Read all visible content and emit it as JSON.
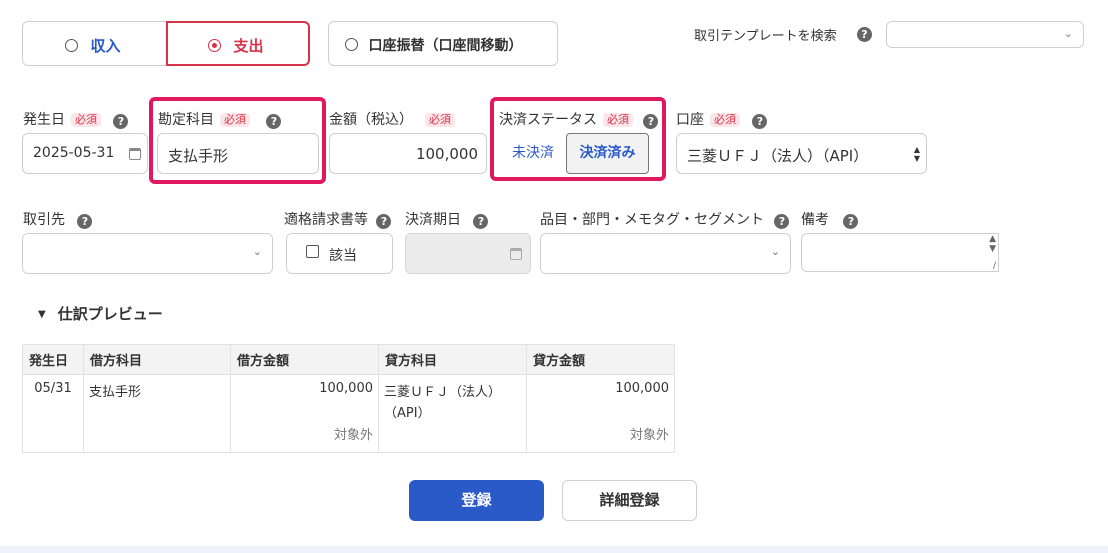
{
  "tabs": {
    "income": "収入",
    "expense": "支出",
    "transfer": "口座振替（口座間移動）"
  },
  "template_search": {
    "label": "取引テンプレートを検索",
    "value": ""
  },
  "required_badge": "必須",
  "fields": {
    "date": {
      "label": "発生日",
      "value": "2025-05-31"
    },
    "account_title": {
      "label": "勘定科目",
      "value": "支払手形"
    },
    "amount": {
      "label": "金額（税込）",
      "value": "100,000"
    },
    "status": {
      "label": "決済ステータス",
      "options": [
        "未決済",
        "決済済み"
      ],
      "selected": "決済済み"
    },
    "account": {
      "label": "口座",
      "value": "三菱ＵＦＪ（法人）（API）"
    },
    "partner": {
      "label": "取引先",
      "value": ""
    },
    "invoice": {
      "label": "適格請求書等",
      "checkbox_label": "該当",
      "checked": false
    },
    "due_date": {
      "label": "決済期日",
      "value": ""
    },
    "items": {
      "label": "品目・部門・メモタグ・セグメント",
      "value": ""
    },
    "memo": {
      "label": "備考",
      "value": ""
    }
  },
  "preview": {
    "title": "仕訳プレビュー",
    "headers": [
      "発生日",
      "借方科目",
      "借方金額",
      "貸方科目",
      "貸方金額"
    ],
    "row": {
      "date": "05/31",
      "debit_account": "支払手形",
      "debit_amount": "100,000",
      "debit_tax": "対象外",
      "credit_account_line1": "三菱ＵＦＪ（法人）",
      "credit_account_line2": "（API）",
      "credit_amount": "100,000",
      "credit_tax": "対象外"
    }
  },
  "buttons": {
    "register": "登録",
    "detail_register": "詳細登録"
  },
  "colors": {
    "accent_red": "#d6334a",
    "highlight": "#e0195f",
    "primary_blue": "#2a5ac8",
    "income_blue": "#2a5ac8"
  }
}
